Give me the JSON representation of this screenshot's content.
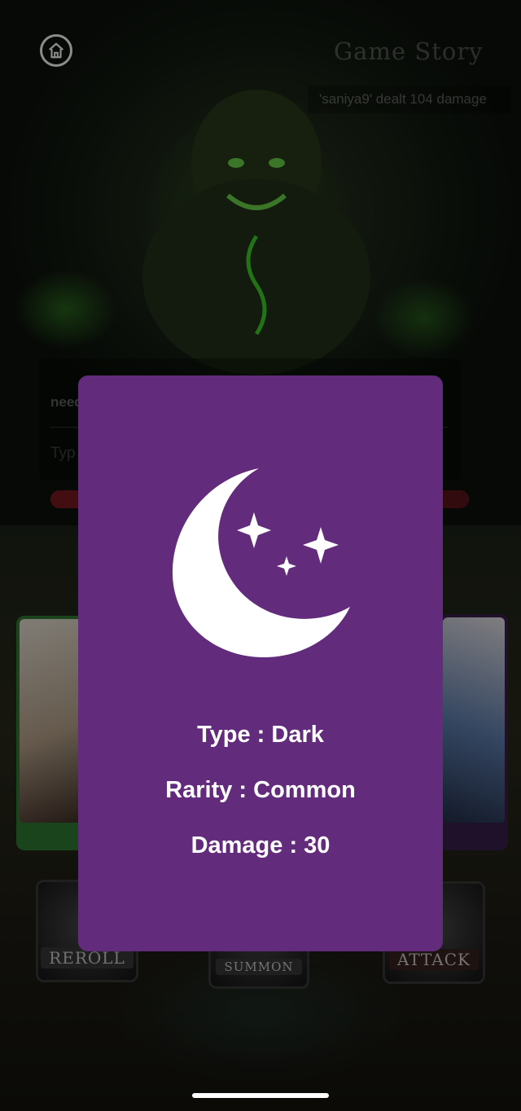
{
  "header": {
    "title": "Game Story",
    "log_text": "'saniya9' dealt 104 damage"
  },
  "chat": {
    "preview_text": "need",
    "input_placeholder": "Typ"
  },
  "boss": {
    "hp_fraction": 1.0
  },
  "actions": {
    "reroll_label": "REROLL",
    "summon_label": "SUMMON",
    "attack_label": "ATTACK"
  },
  "card_popup": {
    "icon": "crescent-moon-stars-icon",
    "type_text": "Type : Dark",
    "rarity_text": "Rarity : Common",
    "damage_text": "Damage : 30",
    "background_color": "#632b7b"
  }
}
